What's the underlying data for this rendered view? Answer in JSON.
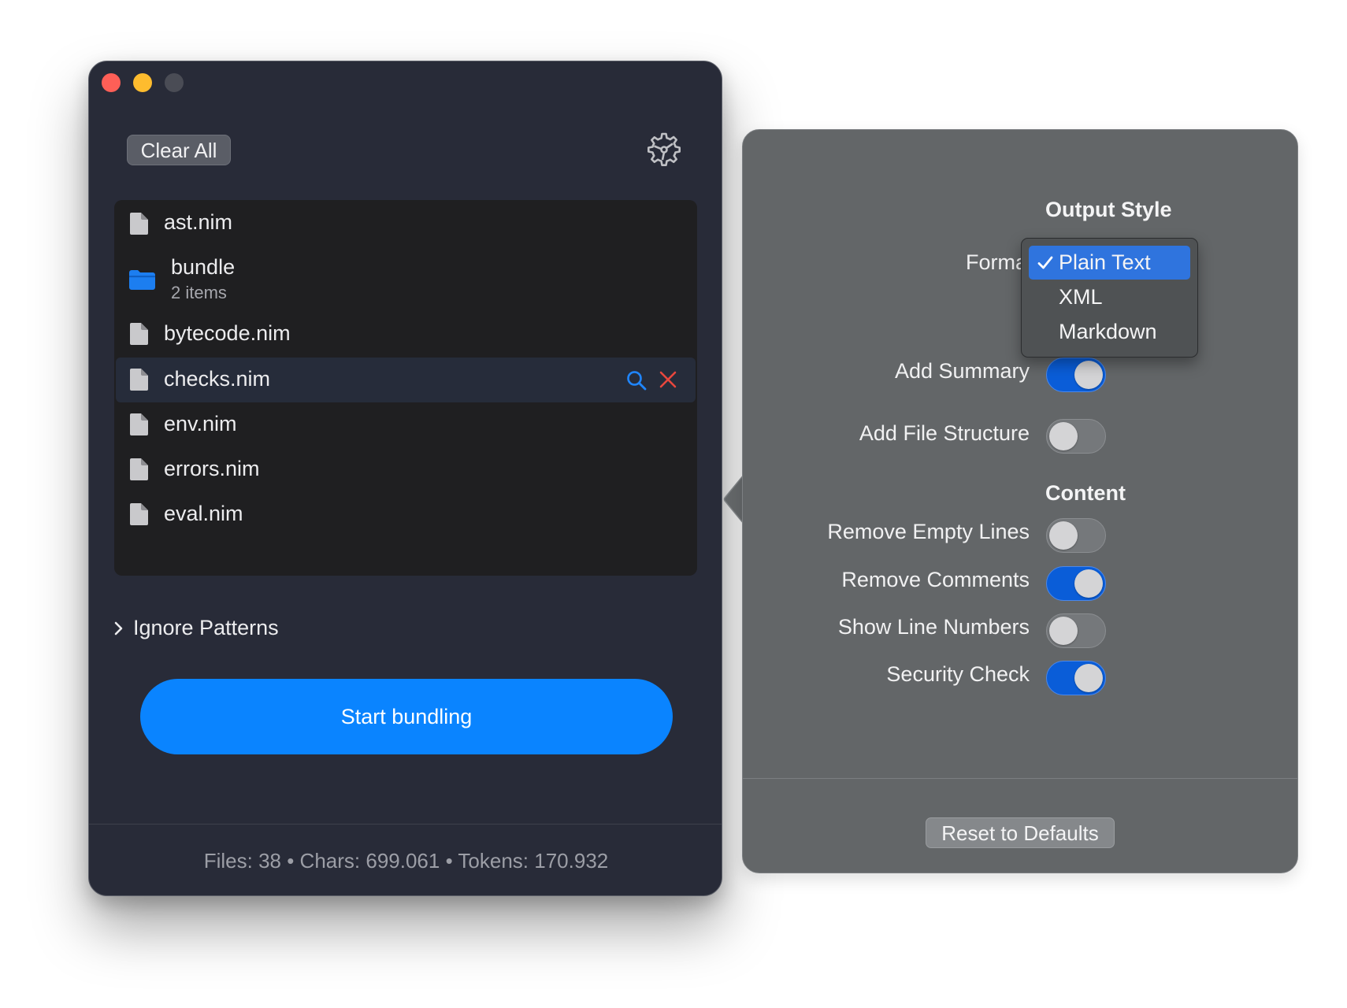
{
  "window": {
    "clear_all_label": "Clear All",
    "files": [
      {
        "name": "ast.nim",
        "type": "file"
      },
      {
        "name": "bundle",
        "type": "folder",
        "subtitle": "2 items"
      },
      {
        "name": "bytecode.nim",
        "type": "file"
      },
      {
        "name": "checks.nim",
        "type": "file",
        "selected": true
      },
      {
        "name": "env.nim",
        "type": "file"
      },
      {
        "name": "errors.nim",
        "type": "file"
      },
      {
        "name": "eval.nim",
        "type": "file"
      }
    ],
    "ignore_patterns_label": "Ignore Patterns",
    "start_button_label": "Start bundling",
    "stats": "Files: 38 • Chars: 699.061 • Tokens: 170.932"
  },
  "settings": {
    "output_style_title": "Output Style",
    "format_label": "Format",
    "format_options": [
      "Plain Text",
      "XML",
      "Markdown"
    ],
    "format_selected": "Plain Text",
    "add_summary": {
      "label": "Add Summary",
      "on": true
    },
    "add_file_structure": {
      "label": "Add File Structure",
      "on": false
    },
    "content_title": "Content",
    "remove_empty_lines": {
      "label": "Remove Empty Lines",
      "on": false
    },
    "remove_comments": {
      "label": "Remove Comments",
      "on": true
    },
    "show_line_numbers": {
      "label": "Show Line Numbers",
      "on": false
    },
    "security_check": {
      "label": "Security Check",
      "on": true
    },
    "reset_label": "Reset to Defaults"
  },
  "colors": {
    "accent": "#0a84ff",
    "window_bg": "#282b38",
    "popover_bg": "#636668",
    "toggle_on": "#0a5dd8"
  },
  "icons": {
    "settings": "gear-icon",
    "file": "document-icon",
    "folder": "folder-icon",
    "reveal": "magnifier-icon",
    "remove": "close-icon",
    "expand": "chevron-right-icon",
    "selected_mark": "checkmark-icon"
  }
}
